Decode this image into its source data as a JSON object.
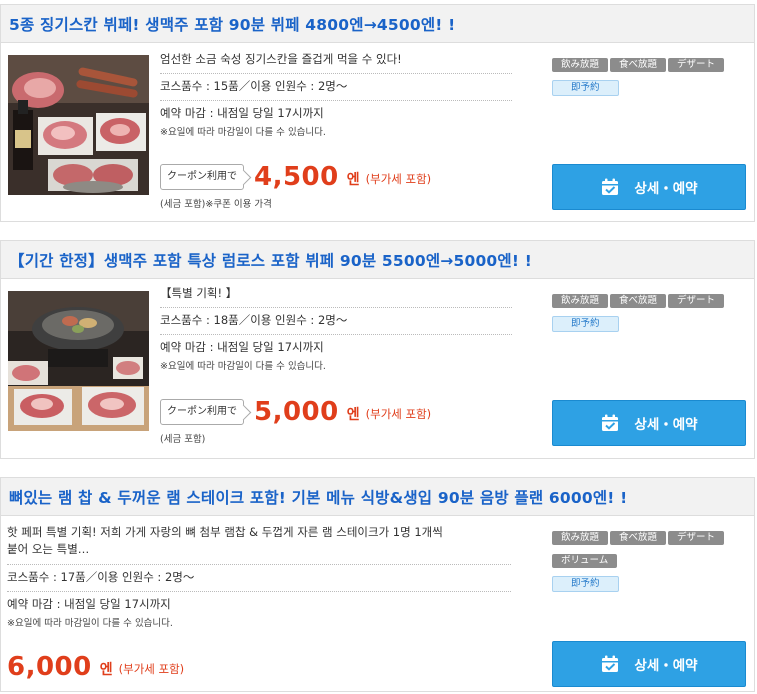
{
  "plans": [
    {
      "title": "5종 징기스칸 뷔페! 생맥주 포함 90분 뷔페 4800엔→4500엔! !",
      "catch": "엄선한 소금 숙성 징기스칸을 즐겁게 먹을 수 있다!",
      "courses": "코스품수 : 15품／이용 인원수 : 2명～",
      "deadline": "예약 마감 : 내점일 당일 17시까지",
      "deadline_note": "※요일에 따라 마감일이 다를 수 있습니다.",
      "coupon": "クーポン利用で",
      "price": "4,500",
      "yen": "엔",
      "tax": "(부가세 포함)",
      "price_note": "(세금 포함)※쿠폰 이용 가격",
      "tags": [
        "飲み放題",
        "食べ放題",
        "デザート"
      ],
      "reserve_tag": "即予約",
      "cta": "상세・예약"
    },
    {
      "title": "【기간 한정】생맥주 포함 특상 럼로스 포함 뷔페 90분 5500엔→5000엔! !",
      "catch": "【특별 기획! 】",
      "courses": "코스품수 : 18품／이용 인원수 : 2명～",
      "deadline": "예약 마감 : 내점일 당일 17시까지",
      "deadline_note": "※요일에 따라 마감일이 다를 수 있습니다.",
      "coupon": "クーポン利用で",
      "price": "5,000",
      "yen": "엔",
      "tax": "(부가세 포함)",
      "price_note": "(세금 포함)",
      "tags": [
        "飲み放題",
        "食べ放題",
        "デザート"
      ],
      "reserve_tag": "即予約",
      "cta": "상세・예약"
    },
    {
      "title": "뼈있는 램 찹 & 두꺼운 램 스테이크 포함! 기본 메뉴 식방&생입 90분 음방 플랜 6000엔! !",
      "catch_1": "핫 페퍼 특별 기획! 저희 가게 자랑의 뼈 첨부 램찹 & 두껍게 자른 램 스테이크가 1명 1개씩",
      "catch_2": "붙어 오는 특별…",
      "courses": "코스품수 : 17품／이용 인원수 : 2명～",
      "deadline": "예약 마감 : 내점일 당일 17시까지",
      "deadline_note": "※요일에 따라 마감일이 다를 수 있습니다.",
      "price": "6,000",
      "yen": "엔",
      "tax": "(부가세 포함)",
      "tags": [
        "飲み放題",
        "食べ放題",
        "デザート",
        "ボリューム"
      ],
      "reserve_tag": "即予約",
      "cta": "상세・예약"
    }
  ],
  "colors": {
    "title": "#1a63c8",
    "price": "#e03e1b",
    "cta": "#2ea1e4",
    "tag": "#8c8c8c"
  },
  "icons": {
    "cta": "calendar-check-icon",
    "photo": "food-photo"
  }
}
